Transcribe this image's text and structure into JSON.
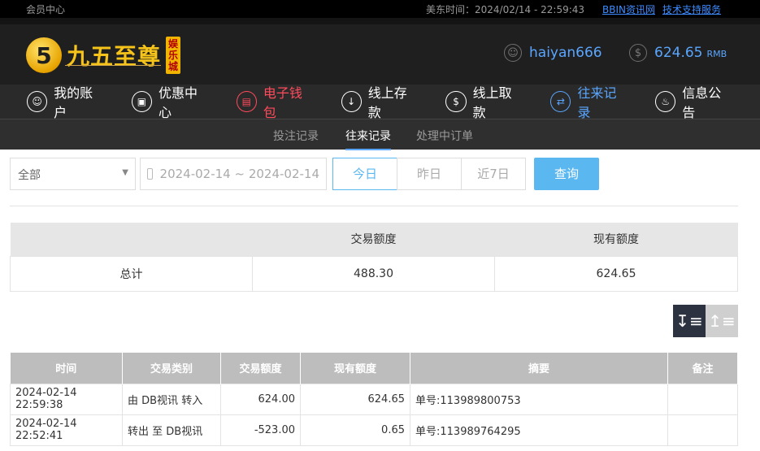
{
  "topbar": {
    "member_center": "会员中心",
    "time_label": "美东时间：",
    "time_value": "2024/02/14 - 22:59:43",
    "link_bbin": "BBIN资讯网",
    "link_support": "技术支持服务"
  },
  "logo": {
    "badge": "5",
    "text": "九五至尊",
    "side": "娱乐城"
  },
  "user": {
    "username": "haiyan666",
    "balance": "624.65",
    "currency": "RMB"
  },
  "nav": {
    "items": [
      {
        "label": "我的账户",
        "icon": "user-icon"
      },
      {
        "label": "优惠中心",
        "icon": "gift-icon"
      },
      {
        "label": "电子钱包",
        "icon": "wallet-icon"
      },
      {
        "label": "线上存款",
        "icon": "deposit-icon"
      },
      {
        "label": "线上取款",
        "icon": "withdraw-icon"
      },
      {
        "label": "往来记录",
        "icon": "record-icon"
      },
      {
        "label": "信息公告",
        "icon": "bell-icon"
      }
    ]
  },
  "subnav": {
    "items": [
      "投注记录",
      "往来记录",
      "处理中订单"
    ]
  },
  "filters": {
    "select_value": "全部",
    "date_range": "2024-02-14 ~ 2024-02-14",
    "today": "今日",
    "yesterday": "昨日",
    "last7": "近7日",
    "query": "查询"
  },
  "summary": {
    "headers": [
      "",
      "交易额度",
      "现有额度"
    ],
    "row": [
      "总计",
      "488.30",
      "624.65"
    ]
  },
  "records": {
    "headers": [
      "时间",
      "交易类别",
      "交易额度",
      "现有额度",
      "摘要",
      "备注"
    ],
    "rows": [
      [
        "2024-02-14 22:59:38",
        "由 DB视讯 转入",
        "624.00",
        "624.65",
        "单号:113989800753",
        ""
      ],
      [
        "2024-02-14 22:52:41",
        "转出 至 DB视讯",
        "-523.00",
        "0.65",
        "单号:113989764295",
        ""
      ]
    ]
  },
  "colors": {
    "accent_blue": "#5aa6ff",
    "nav_red": "#ff4b5c",
    "query_blue": "#5ab7f0",
    "gold": "#f6c31a"
  }
}
